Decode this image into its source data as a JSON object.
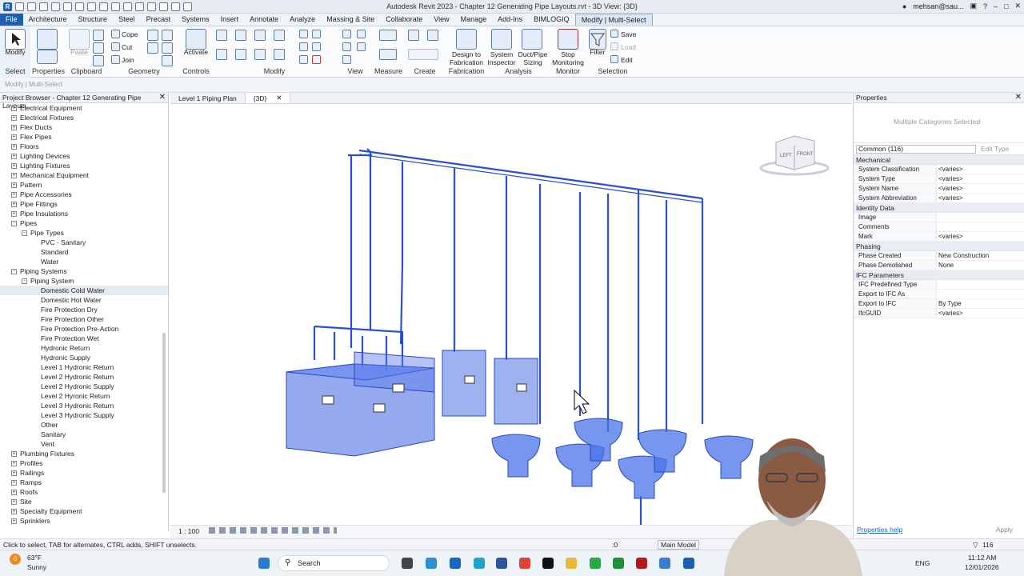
{
  "app": {
    "title": "Autodesk Revit 2023 - Chapter 12 Generating Pipe Layouts.rvt - 3D View: {3D}",
    "user": "mehsan@sau..."
  },
  "tabs": [
    "File",
    "Architecture",
    "Structure",
    "Steel",
    "Precast",
    "Systems",
    "Insert",
    "Annotate",
    "Analyze",
    "Massing & Site",
    "Collaborate",
    "View",
    "Manage",
    "Add-Ins",
    "BIMLOGIQ",
    "Modify | Multi-Select"
  ],
  "ribbon": {
    "select": {
      "modify": "Modify",
      "label": "Select"
    },
    "properties": {
      "label": "Properties"
    },
    "clipboard": {
      "paste": "Paste",
      "label": "Clipboard"
    },
    "geometry": {
      "cope": "Cope",
      "cut": "Cut",
      "join": "Join",
      "label": "Geometry"
    },
    "controls": {
      "activate": "Activate",
      "label": "Controls"
    },
    "modify": {
      "label": "Modify"
    },
    "view": {
      "label": "View"
    },
    "measure": {
      "label": "Measure"
    },
    "create": {
      "label": "Create"
    },
    "fabrication": {
      "btn1": "Design to",
      "btn2": "Fabrication",
      "label": "Fabrication"
    },
    "analysis": {
      "b1a": "System",
      "b1b": "Inspector",
      "b2a": "Duct/Pipe",
      "b2b": "Sizing",
      "label": "Analysis"
    },
    "monitor": {
      "b1": "Stop",
      "b2": "Monitoring",
      "label": "Monitor"
    },
    "selection": {
      "filter": "Filter",
      "save": "Save",
      "load": "Load",
      "edit": "Edit",
      "label": "Selection"
    }
  },
  "context_bar": "Modify | Multi-Select",
  "project_browser": {
    "title": "Project Browser - Chapter 12 Generating Pipe Layouts...",
    "items": [
      {
        "label": "Electrical Equipment",
        "level": 1,
        "exp": "+"
      },
      {
        "label": "Electrical Fixtures",
        "level": 1,
        "exp": "+"
      },
      {
        "label": "Flex Ducts",
        "level": 1,
        "exp": "+"
      },
      {
        "label": "Flex Pipes",
        "level": 1,
        "exp": "+"
      },
      {
        "label": "Floors",
        "level": 1,
        "exp": "+"
      },
      {
        "label": "Lighting Devices",
        "level": 1,
        "exp": "+"
      },
      {
        "label": "Lighting Fixtures",
        "level": 1,
        "exp": "+"
      },
      {
        "label": "Mechanical Equipment",
        "level": 1,
        "exp": "+"
      },
      {
        "label": "Pattern",
        "level": 1,
        "exp": "+"
      },
      {
        "label": "Pipe Accessories",
        "level": 1,
        "exp": "+"
      },
      {
        "label": "Pipe Fittings",
        "level": 1,
        "exp": "+"
      },
      {
        "label": "Pipe Insulations",
        "level": 1,
        "exp": "+"
      },
      {
        "label": "Pipes",
        "level": 1,
        "exp": "-"
      },
      {
        "label": "Pipe Types",
        "level": 2,
        "exp": "-"
      },
      {
        "label": "PVC - Sanitary",
        "level": 3,
        "exp": ""
      },
      {
        "label": "Standard",
        "level": 3,
        "exp": ""
      },
      {
        "label": "Water",
        "level": 3,
        "exp": ""
      },
      {
        "label": "Piping Systems",
        "level": 1,
        "exp": "-"
      },
      {
        "label": "Piping System",
        "level": 2,
        "exp": "-"
      },
      {
        "label": "Domestic Cold Water",
        "level": 3,
        "exp": "",
        "selected": true
      },
      {
        "label": "Domestic Hot Water",
        "level": 3,
        "exp": ""
      },
      {
        "label": "Fire Protection Dry",
        "level": 3,
        "exp": ""
      },
      {
        "label": "Fire Protection Other",
        "level": 3,
        "exp": ""
      },
      {
        "label": "Fire Protection Pre-Action",
        "level": 3,
        "exp": ""
      },
      {
        "label": "Fire Protection Wet",
        "level": 3,
        "exp": ""
      },
      {
        "label": "Hydronic Return",
        "level": 3,
        "exp": ""
      },
      {
        "label": "Hydronic Supply",
        "level": 3,
        "exp": ""
      },
      {
        "label": "Level 1 Hydronic Return",
        "level": 3,
        "exp": ""
      },
      {
        "label": "Level 2 Hydronic Return",
        "level": 3,
        "exp": ""
      },
      {
        "label": "Level 2 Hydronic Supply",
        "level": 3,
        "exp": ""
      },
      {
        "label": "Level 2 Hyronic Return",
        "level": 3,
        "exp": ""
      },
      {
        "label": "Level 3 Hydronic Return",
        "level": 3,
        "exp": ""
      },
      {
        "label": "Level 3 Hydronic Supply",
        "level": 3,
        "exp": ""
      },
      {
        "label": "Other",
        "level": 3,
        "exp": ""
      },
      {
        "label": "Sanitary",
        "level": 3,
        "exp": ""
      },
      {
        "label": "Vent",
        "level": 3,
        "exp": ""
      },
      {
        "label": "Plumbing Fixtures",
        "level": 1,
        "exp": "+"
      },
      {
        "label": "Profiles",
        "level": 1,
        "exp": "+"
      },
      {
        "label": "Railings",
        "level": 1,
        "exp": "+"
      },
      {
        "label": "Ramps",
        "level": 1,
        "exp": "+"
      },
      {
        "label": "Roofs",
        "level": 1,
        "exp": "+"
      },
      {
        "label": "Site",
        "level": 1,
        "exp": "+"
      },
      {
        "label": "Specialty Equipment",
        "level": 1,
        "exp": "+"
      },
      {
        "label": "Sprinklers",
        "level": 1,
        "exp": "+"
      }
    ]
  },
  "view_tabs": [
    {
      "label": "Level 1 Piping Plan",
      "active": false
    },
    {
      "label": "{3D}",
      "active": true
    }
  ],
  "viewcube": {
    "left": "LEFT",
    "front": "FRONT"
  },
  "view_bar": {
    "scale": "1 : 100"
  },
  "properties": {
    "title": "Properties",
    "type_selector": "Multiple Categories Selected",
    "filter": "Common (116)",
    "edit_type": "Edit Type",
    "sections": [
      {
        "name": "Mechanical",
        "rows": [
          [
            "System Classification",
            "<varies>"
          ],
          [
            "System Type",
            "<varies>"
          ],
          [
            "System Name",
            "<varies>"
          ],
          [
            "System Abbreviation",
            "<varies>"
          ]
        ]
      },
      {
        "name": "Identity Data",
        "rows": [
          [
            "Image",
            ""
          ],
          [
            "Comments",
            ""
          ],
          [
            "Mark",
            "<varies>"
          ]
        ]
      },
      {
        "name": "Phasing",
        "rows": [
          [
            "Phase Created",
            "New Construction"
          ],
          [
            "Phase Demolished",
            "None"
          ]
        ]
      },
      {
        "name": "IFC Parameters",
        "rows": [
          [
            "IFC Predefined Type",
            ""
          ],
          [
            "Export to IFC As",
            ""
          ],
          [
            "Export to IFC",
            "By Type"
          ],
          [
            "IfcGUID",
            "<varies>"
          ]
        ]
      }
    ],
    "help": "Properties help",
    "apply": "Apply"
  },
  "status": {
    "text": "Click to select, TAB for alternates, CTRL adds, SHIFT unselects.",
    "zero": ":0",
    "model": "Main Model",
    "count": "116"
  },
  "taskbar": {
    "temp": "63°F",
    "weather": "Sunny",
    "badge": "6",
    "search": "Search",
    "lang": "ENG",
    "time": "11:12 AM",
    "date": "12/01/2026"
  },
  "colors": {
    "accent": "#1d5fb3",
    "pipe": "#2a4fd0",
    "fixture": "#4a74e8"
  }
}
